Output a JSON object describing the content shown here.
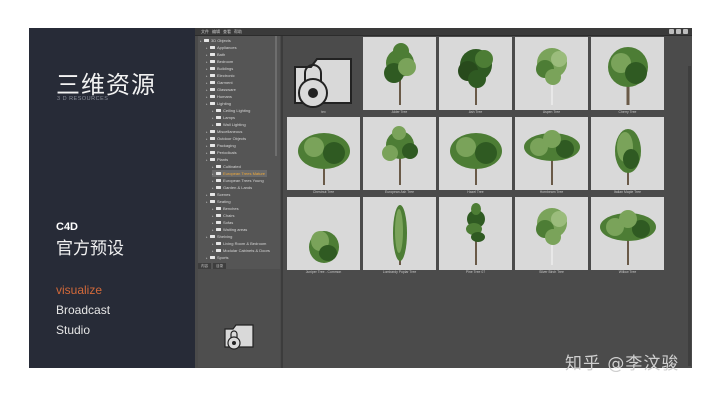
{
  "left_panel": {
    "title": "三维资源",
    "subtitle": "3 D RESOURCES",
    "section_label": "C4D",
    "section_title": "官方预设",
    "nav": [
      "visualize",
      "Broadcast",
      "Studio"
    ],
    "active_color": "#d2693a"
  },
  "app": {
    "menu": [
      "文件",
      "编辑",
      "查看",
      "帮助"
    ],
    "tree": [
      {
        "label": "3D Objects",
        "level": 0
      },
      {
        "label": "Appliances",
        "level": 1
      },
      {
        "label": "Bath",
        "level": 1
      },
      {
        "label": "Bedroom",
        "level": 1
      },
      {
        "label": "Buildings",
        "level": 1
      },
      {
        "label": "Electronic",
        "level": 1
      },
      {
        "label": "Garment",
        "level": 1
      },
      {
        "label": "Glassware",
        "level": 1
      },
      {
        "label": "Humans",
        "level": 1
      },
      {
        "label": "Lighting",
        "level": 1
      },
      {
        "label": "Ceiling Lighting",
        "level": 2
      },
      {
        "label": "Lamps",
        "level": 2
      },
      {
        "label": "Wall Lighting",
        "level": 2
      },
      {
        "label": "Miscellaneous",
        "level": 1
      },
      {
        "label": "Outdoor Objects",
        "level": 1
      },
      {
        "label": "Packaging",
        "level": 1
      },
      {
        "label": "Periodicals",
        "level": 1
      },
      {
        "label": "Plants",
        "level": 1
      },
      {
        "label": "Cultivated",
        "level": 2
      },
      {
        "label": "European Trees Mature",
        "level": 2,
        "selected": true
      },
      {
        "label": "European Trees Young",
        "level": 2
      },
      {
        "label": "Garden & Lands",
        "level": 2
      },
      {
        "label": "Scenes",
        "level": 1
      },
      {
        "label": "Seating",
        "level": 1
      },
      {
        "label": "Benches",
        "level": 2
      },
      {
        "label": "Chairs",
        "level": 2
      },
      {
        "label": "Sofas",
        "level": 2
      },
      {
        "label": "Waiting areas",
        "level": 2
      },
      {
        "label": "Shelving",
        "level": 1
      },
      {
        "label": "Living Room & Bedroom",
        "level": 2
      },
      {
        "label": "Modular Cabinets & Doors",
        "level": 2
      },
      {
        "label": "Sports",
        "level": 1
      }
    ],
    "bottom_tabs": [
      "内容",
      "目录"
    ],
    "tiles": [
      {
        "label": "tex",
        "type": "locked"
      },
      {
        "label": "Alder Tree",
        "type": "tree",
        "shape": "pine"
      },
      {
        "label": "Ash Tree",
        "type": "tree",
        "shape": "dark"
      },
      {
        "label": "Aspen Tree",
        "type": "tree",
        "shape": "birch"
      },
      {
        "label": "Cherry Tree",
        "type": "tree",
        "shape": "round"
      },
      {
        "label": "Chestnut Tree",
        "type": "tree",
        "shape": "wide"
      },
      {
        "label": "European Ash Tree",
        "type": "tree",
        "shape": "sparse"
      },
      {
        "label": "Hazel Tree",
        "type": "tree",
        "shape": "wide"
      },
      {
        "label": "Hornbeam Tree",
        "type": "tree",
        "shape": "spread"
      },
      {
        "label": "Italian Maple Tree",
        "type": "tree",
        "shape": "cone"
      },
      {
        "label": "Juniper Tree - Common",
        "type": "tree",
        "shape": "shrub"
      },
      {
        "label": "Lombardy Poplar Tree",
        "type": "tree",
        "shape": "column"
      },
      {
        "label": "Pine Tree 07",
        "type": "tree",
        "shape": "tallpine"
      },
      {
        "label": "Silver Birch Tree",
        "type": "tree",
        "shape": "birch"
      },
      {
        "label": "Willow Tree",
        "type": "tree",
        "shape": "spread"
      }
    ],
    "colors": {
      "leaf_dark": "#2f5a22",
      "leaf_mid": "#4d7d35",
      "leaf_light": "#7aa35a",
      "trunk": "#6a5a48"
    }
  },
  "watermark": "知乎 @李汶骏"
}
